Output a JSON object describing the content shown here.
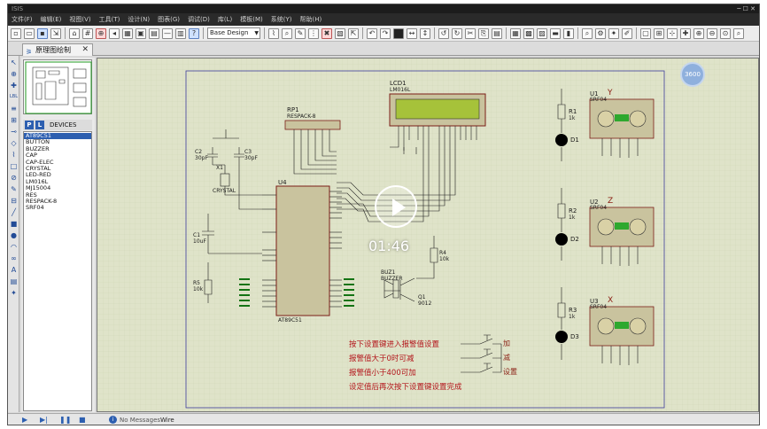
{
  "window": {
    "title": "ISIS",
    "controls": "─ ☐ ✕"
  },
  "menu": [
    "文件(F)",
    "编辑(E)",
    "视图(V)",
    "工具(T)",
    "设计(N)",
    "图表(G)",
    "调试(D)",
    "库(L)",
    "模板(M)",
    "系统(Y)",
    "帮助(H)"
  ],
  "toolbar": {
    "layer_select": "Base Design"
  },
  "tab": {
    "label": "原理图绘制"
  },
  "left_tools": [
    "↖",
    "⊕",
    "✚",
    "LBL",
    "≡",
    "⊞",
    "⊸",
    "◇",
    "⌇",
    "□",
    "⊘",
    "✎",
    "⊟",
    "╱",
    "■",
    "●",
    "◠",
    "∞",
    "A",
    "▤",
    "✦"
  ],
  "devices_panel": {
    "p_label": "P",
    "l_label": "L",
    "title": "DEVICES",
    "items": [
      "AT89C51",
      "BUTTON",
      "BUZZER",
      "CAP",
      "CAP-ELEC",
      "CRYSTAL",
      "LED-RED",
      "LM016L",
      "MJ15004",
      "RES",
      "RESPACK-8",
      "SRF04"
    ],
    "selected_index": 0
  },
  "video": {
    "time": "01:46",
    "badge": "3600"
  },
  "schematic": {
    "components": {
      "lcd": {
        "ref": "LCD1",
        "part": "LM016L"
      },
      "rp1": {
        "ref": "RP1",
        "part": "RESPACK-8"
      },
      "u4": {
        "ref": "U4",
        "part": "AT89C51"
      },
      "c2": {
        "ref": "C2",
        "value": "30pF"
      },
      "c3": {
        "ref": "C3",
        "value": "30pF"
      },
      "x1": {
        "ref": "X1",
        "value": "CRYSTAL"
      },
      "c1": {
        "ref": "C1",
        "value": "10uF"
      },
      "r5": {
        "ref": "R5",
        "value": "10k"
      },
      "buz1": {
        "ref": "BUZ1",
        "part": "BUZZER"
      },
      "r4": {
        "ref": "R4",
        "value": "10k"
      },
      "q1": {
        "ref": "Q1",
        "part": "9012"
      },
      "u1": {
        "ref": "U1",
        "part": "SRF04",
        "axis": "Y"
      },
      "u2": {
        "ref": "U2",
        "part": "SRF04",
        "axis": "Z"
      },
      "u3": {
        "ref": "U3",
        "part": "SRF04",
        "axis": "X"
      },
      "r1": {
        "ref": "R1",
        "value": "1k"
      },
      "r2": {
        "ref": "R2",
        "value": "1k"
      },
      "r3": {
        "ref": "R3",
        "value": "1k"
      },
      "d1": {
        "ref": "D1"
      },
      "d2": {
        "ref": "D2"
      },
      "d3": {
        "ref": "D3"
      }
    },
    "notes": [
      "按下设置键进入报警值设置",
      "报警值大于0时可减",
      "报警值小于400可加",
      "设定值后再次按下设置键设置完成"
    ],
    "switch_labels": [
      "加",
      "减",
      "设置"
    ]
  },
  "statusbar": {
    "messages": "No Messages",
    "mode": "Wire"
  }
}
